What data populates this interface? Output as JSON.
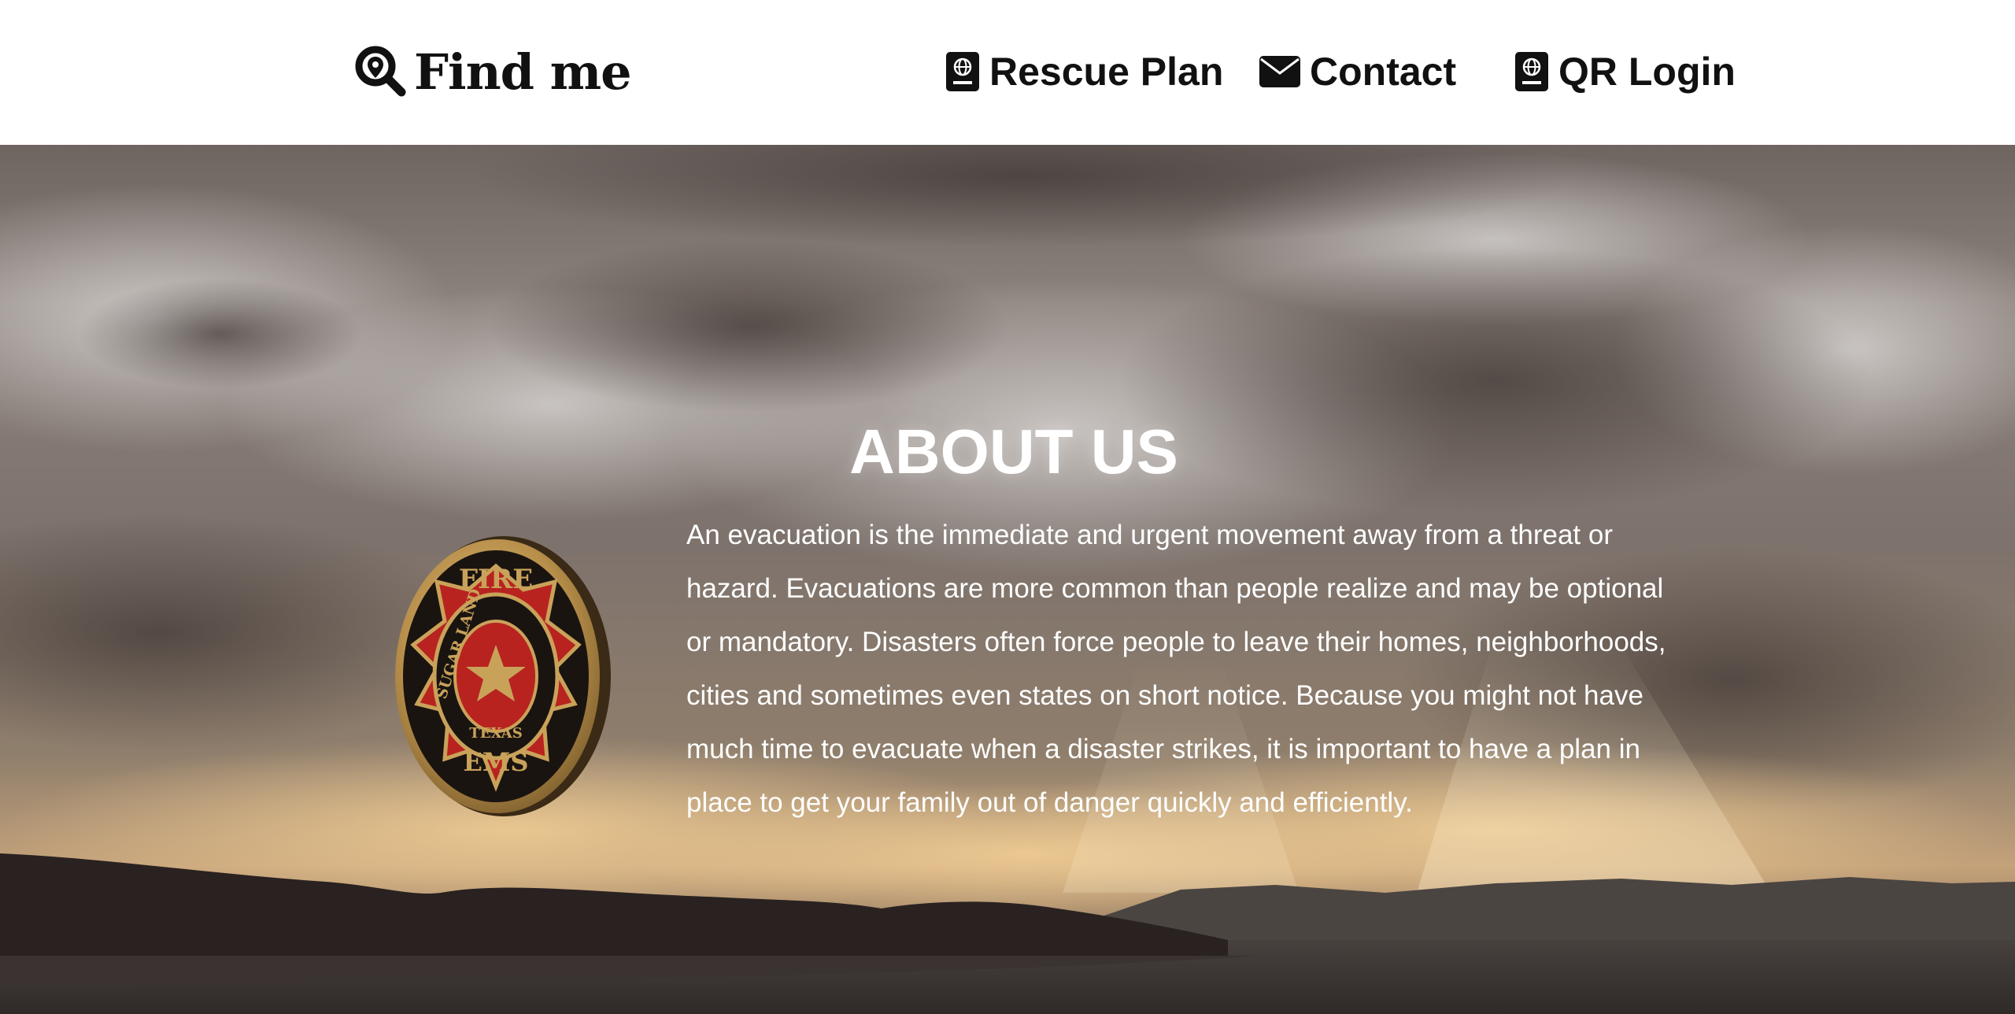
{
  "header": {
    "brand": {
      "label": "Find me",
      "icon": "search-location-icon"
    },
    "nav": [
      {
        "id": "rescue",
        "label": "Rescue Plan",
        "icon": "passport-icon"
      },
      {
        "id": "contact",
        "label": "Contact",
        "icon": "envelope-icon"
      },
      {
        "id": "qr",
        "label": "QR Login",
        "icon": "passport-icon"
      }
    ]
  },
  "about": {
    "title": "ABOUT US",
    "body": "An evacuation is the immediate and urgent movement away from a threat or hazard. Evacuations are more common than people realize and may be optional or mandatory. Disasters often force people to leave their homes, neighborhoods, cities and sometimes even states on short notice. Because you might not have much time to evacuate when a disaster strikes, it is important to have a plan in place to get your family out of danger quickly and efficiently."
  },
  "badge": {
    "top_text": "FIRE",
    "ring_text": "SUGAR LAND",
    "state_text": "TEXAS",
    "bottom_text": "EMS",
    "colors": {
      "gold": "#c9a25a",
      "red": "#b8231f",
      "black": "#1a1410"
    }
  },
  "colors": {
    "text_dark": "#111111",
    "hero_text": "#ffffff"
  }
}
